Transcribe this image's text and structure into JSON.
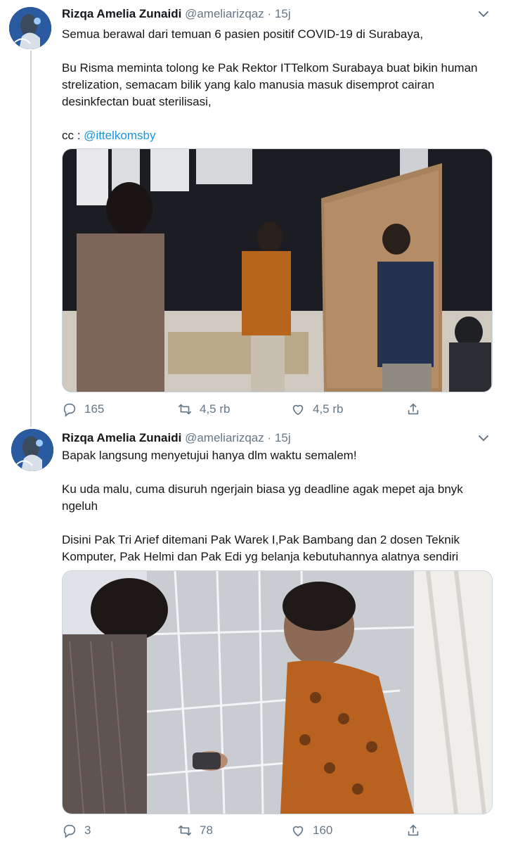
{
  "tweets": [
    {
      "name": "Rizqa Amelia Zunaidi",
      "handle": "@ameliarizqaz",
      "separator": "·",
      "time": "15j",
      "text": "Semua berawal dari temuan 6 pasien positif COVID-19 di Surabaya,\n\nBu Risma meminta tolong ke Pak Rektor ITTelkom Surabaya buat bikin human strelization, semacam bilik yang kalo manusia masuk disemprot cairan desinkfectan buat sterilisasi,\n\ncc : ",
      "mention": "@ittelkomsby",
      "replies": "165",
      "retweets": "4,5 rb",
      "likes": "4,5 rb"
    },
    {
      "name": "Rizqa Amelia Zunaidi",
      "handle": "@ameliarizqaz",
      "separator": "·",
      "time": "15j",
      "text": "Bapak langsung menyetujui hanya dlm waktu semalem!\n\nKu uda malu, cuma disuruh ngerjain biasa yg deadline agak mepet aja bnyk ngeluh\n\nDisini Pak Tri Arief ditemani Pak Warek I,Pak Bambang dan 2 dosen Teknik Komputer, Pak Helmi dan Pak Edi yg belanja kebutuhannya alatnya sendiri",
      "replies": "3",
      "retweets": "78",
      "likes": "160"
    }
  ],
  "icons": {
    "reply": "reply-icon",
    "retweet": "retweet-icon",
    "like": "like-icon",
    "share": "share-icon",
    "more": "chevron-down-icon"
  },
  "colors": {
    "link": "#1b95e0",
    "secondary": "#657786",
    "thread_line": "#ccd6dd"
  }
}
